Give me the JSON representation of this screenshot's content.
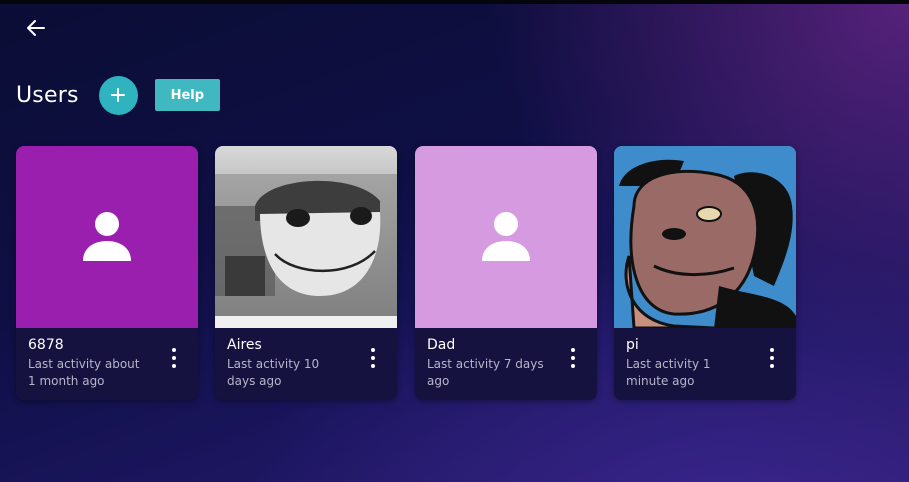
{
  "header": {
    "back_icon": "arrow-left-icon",
    "title": "Users",
    "add_icon": "plus-icon",
    "help_label": "Help"
  },
  "colors": {
    "accent": "#2fb3be",
    "card_background": "#15123f",
    "placeholder_purple": "#9a1fae",
    "placeholder_pink": "#d59ae0"
  },
  "users": [
    {
      "name": "6878",
      "activity": "Last activity about 1 month ago",
      "avatar": "default-person-icon",
      "avatar_bg": "#9a1fae"
    },
    {
      "name": "Aires",
      "activity": "Last activity 10 days ago",
      "avatar": "frog-helmet-picture",
      "avatar_bg": "#8a8a8a"
    },
    {
      "name": "Dad",
      "activity": "Last activity 7 days ago",
      "avatar": "default-person-icon",
      "avatar_bg": "#d59ae0"
    },
    {
      "name": "pi",
      "activity": "Last activity 1 minute ago",
      "avatar": "cartoon-face-picture",
      "avatar_bg": "#3d86c4"
    }
  ]
}
